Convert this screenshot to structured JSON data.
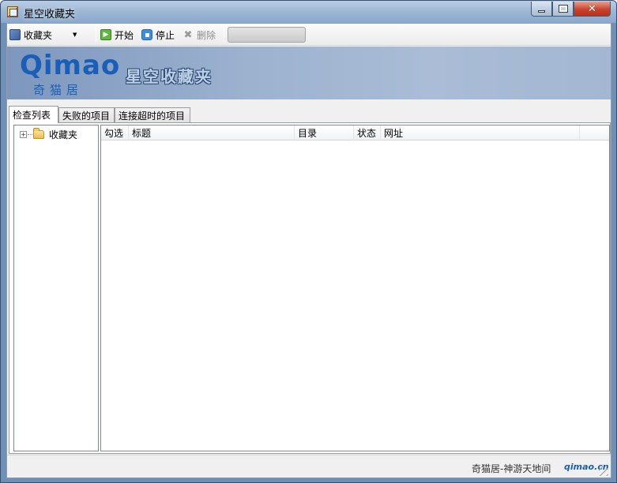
{
  "window": {
    "title": "星空收藏夹"
  },
  "toolbar": {
    "favorites_label": "收藏夹",
    "start_label": "开始",
    "stop_label": "停止",
    "delete_label": "删除"
  },
  "banner": {
    "logo_text": "Qimao",
    "logo_sub": "奇猫居",
    "title": "星空收藏夹"
  },
  "tabs": [
    {
      "label": "检查列表",
      "active": true
    },
    {
      "label": "失败的项目",
      "active": false
    },
    {
      "label": "连接超时的项目",
      "active": false
    }
  ],
  "tree": {
    "root_label": "收藏夹",
    "expander": "+"
  },
  "list": {
    "columns": [
      "勾选",
      "标题",
      "目录",
      "状态",
      "网址"
    ]
  },
  "status": {
    "text": "奇猫居-神游天地间",
    "brand": "qimao.cn"
  },
  "colors": {
    "accent": "#1a5fb7",
    "banner": "#9cb2cf",
    "play": "#5fb93c",
    "stop": "#3d8de0"
  },
  "icons": {
    "app": "app-icon",
    "favorites": "favorites-icon",
    "start": "play-icon",
    "stop": "stop-icon",
    "delete": "delete-x-icon",
    "folder": "folder-icon"
  }
}
